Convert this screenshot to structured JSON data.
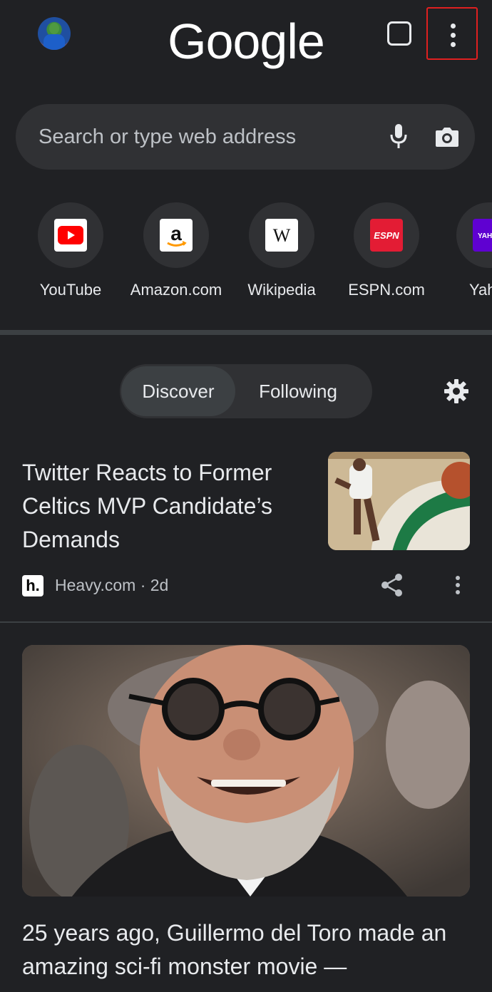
{
  "header": {
    "logo_text": "Google"
  },
  "search": {
    "placeholder": "Search or type web address"
  },
  "shortcuts": [
    {
      "label": "YouTube",
      "icon": "youtube-icon"
    },
    {
      "label": "Amazon.com",
      "icon": "amazon-icon"
    },
    {
      "label": "Wikipedia",
      "icon": "wikipedia-icon"
    },
    {
      "label": "ESPN.com",
      "icon": "espn-icon"
    },
    {
      "label": "Yah",
      "icon": "yahoo-icon"
    }
  ],
  "feed_tabs": {
    "discover": "Discover",
    "following": "Following"
  },
  "articles": [
    {
      "title": "Twitter Reacts to Former Celtics MVP Candidate’s Demands",
      "source": "Heavy.com · 2d",
      "source_icon_text": "h."
    },
    {
      "title": "25 years ago, Guillermo del Toro made an amazing sci-fi monster movie —"
    }
  ],
  "colors": {
    "background": "#202124",
    "surface": "#303134",
    "highlight_box": "#e02020"
  }
}
